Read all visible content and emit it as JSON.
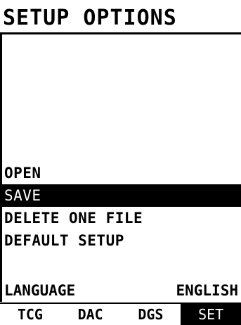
{
  "header": {
    "title": "SETUP OPTIONS"
  },
  "menu": {
    "items": [
      {
        "label": "OPEN",
        "selected": false
      },
      {
        "label": "SAVE",
        "selected": true
      },
      {
        "label": "DELETE ONE FILE",
        "selected": false
      },
      {
        "label": "DEFAULT SETUP",
        "selected": false
      }
    ]
  },
  "language": {
    "label": "LANGUAGE",
    "value": "ENGLISH"
  },
  "tabs": [
    {
      "label": "TCG",
      "active": false
    },
    {
      "label": "DAC",
      "active": false
    },
    {
      "label": "DGS",
      "active": false
    },
    {
      "label": "SET",
      "active": true
    }
  ],
  "colors": {
    "foreground": "#000000",
    "background": "#ffffff"
  }
}
